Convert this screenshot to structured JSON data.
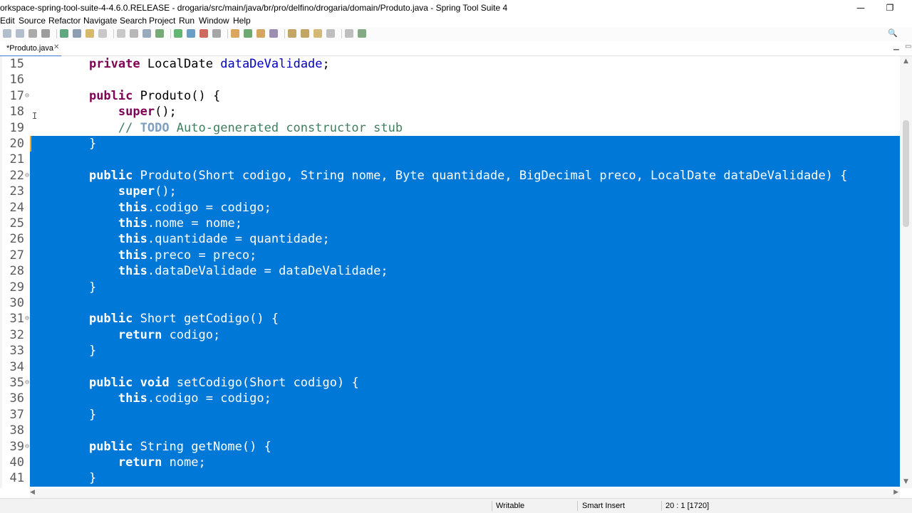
{
  "window": {
    "title": "orkspace-spring-tool-suite-4-4.6.0.RELEASE - drogaria/src/main/java/br/pro/delfino/drogaria/domain/Produto.java - Spring Tool Suite 4",
    "minimize": "—",
    "maximize": "❐"
  },
  "menu": [
    "Edit",
    "Source",
    "Refactor",
    "Navigate",
    "Search",
    "Project",
    "Run",
    "Window",
    "Help"
  ],
  "toolbar": {
    "icons": [
      "save-icon",
      "save-all-icon",
      "print-icon",
      "cut-icon",
      "debug-icon",
      "build-icon",
      "toggle-mark-icon",
      "block-select-icon",
      "show-whitespace-icon",
      "paragraph-icon",
      "skip-breakpoints-icon",
      "run-debug-icon",
      "run-icon",
      "run-coverage-icon",
      "stop-icon",
      "external-tools-icon",
      "new-java-icon",
      "new-class-icon",
      "open-type-icon",
      "search-icon",
      "next-annotation-icon",
      "prev-annotation-icon",
      "last-edit-icon",
      "back-icon",
      "forward-icon",
      "pin-editor-icon"
    ],
    "search_icon": "🔍"
  },
  "editor_tab": {
    "label": "*Produto.java",
    "close": "✕"
  },
  "code": {
    "lines": [
      {
        "n": "15",
        "fold": "",
        "sel": false,
        "tokens": [
          [
            "",
            "    "
          ],
          [
            "kw",
            "private"
          ],
          [
            "",
            " "
          ],
          [
            "ty",
            "LocalDate"
          ],
          [
            "",
            " "
          ],
          [
            "fld",
            "dataDeValidade"
          ],
          [
            "",
            ";"
          ]
        ]
      },
      {
        "n": "16",
        "fold": "",
        "sel": false,
        "tokens": []
      },
      {
        "n": "17",
        "fold": "⊖",
        "sel": false,
        "tokens": [
          [
            "",
            "    "
          ],
          [
            "kw",
            "public"
          ],
          [
            "",
            " Produto() {"
          ]
        ]
      },
      {
        "n": "18",
        "fold": "",
        "sel": false,
        "tokens": [
          [
            "",
            "        "
          ],
          [
            "kw",
            "super"
          ],
          [
            "",
            "();"
          ]
        ]
      },
      {
        "n": "19",
        "fold": "",
        "sel": false,
        "tokens": [
          [
            "",
            "        "
          ],
          [
            "cm",
            "// "
          ],
          [
            "todo",
            "TODO"
          ],
          [
            "cm",
            " Auto-generated constructor stub"
          ]
        ]
      },
      {
        "n": "20",
        "fold": "",
        "sel": true,
        "tokens": [
          [
            "",
            "    }"
          ]
        ]
      },
      {
        "n": "21",
        "fold": "",
        "sel": true,
        "tokens": []
      },
      {
        "n": "22",
        "fold": "⊖",
        "sel": true,
        "tokens": [
          [
            "",
            "    "
          ],
          [
            "kw",
            "public"
          ],
          [
            "",
            " Produto(Short codigo, String nome, Byte quantidade, BigDecimal preco, LocalDate dataDeValidade) {"
          ]
        ]
      },
      {
        "n": "23",
        "fold": "",
        "sel": true,
        "tokens": [
          [
            "",
            "        "
          ],
          [
            "kw",
            "super"
          ],
          [
            "",
            "();"
          ]
        ]
      },
      {
        "n": "24",
        "fold": "",
        "sel": true,
        "tokens": [
          [
            "",
            "        "
          ],
          [
            "kw",
            "this"
          ],
          [
            "",
            "."
          ],
          [
            "fld",
            "codigo"
          ],
          [
            "",
            " = codigo;"
          ]
        ]
      },
      {
        "n": "25",
        "fold": "",
        "sel": true,
        "tokens": [
          [
            "",
            "        "
          ],
          [
            "kw",
            "this"
          ],
          [
            "",
            "."
          ],
          [
            "fld",
            "nome"
          ],
          [
            "",
            " = nome;"
          ]
        ]
      },
      {
        "n": "26",
        "fold": "",
        "sel": true,
        "tokens": [
          [
            "",
            "        "
          ],
          [
            "kw",
            "this"
          ],
          [
            "",
            "."
          ],
          [
            "fld",
            "quantidade"
          ],
          [
            "",
            " = quantidade;"
          ]
        ]
      },
      {
        "n": "27",
        "fold": "",
        "sel": true,
        "tokens": [
          [
            "",
            "        "
          ],
          [
            "kw",
            "this"
          ],
          [
            "",
            "."
          ],
          [
            "fld",
            "preco"
          ],
          [
            "",
            " = preco;"
          ]
        ]
      },
      {
        "n": "28",
        "fold": "",
        "sel": true,
        "tokens": [
          [
            "",
            "        "
          ],
          [
            "kw",
            "this"
          ],
          [
            "",
            "."
          ],
          [
            "fld",
            "dataDeValidade"
          ],
          [
            "",
            " = dataDeValidade;"
          ]
        ]
      },
      {
        "n": "29",
        "fold": "",
        "sel": true,
        "tokens": [
          [
            "",
            "    }"
          ]
        ]
      },
      {
        "n": "30",
        "fold": "",
        "sel": true,
        "tokens": []
      },
      {
        "n": "31",
        "fold": "⊖",
        "sel": true,
        "tokens": [
          [
            "",
            "    "
          ],
          [
            "kw",
            "public"
          ],
          [
            "",
            " Short getCodigo() {"
          ]
        ]
      },
      {
        "n": "32",
        "fold": "",
        "sel": true,
        "tokens": [
          [
            "",
            "        "
          ],
          [
            "kw",
            "return"
          ],
          [
            "",
            " "
          ],
          [
            "fld",
            "codigo"
          ],
          [
            "",
            ";"
          ]
        ]
      },
      {
        "n": "33",
        "fold": "",
        "sel": true,
        "tokens": [
          [
            "",
            "    }"
          ]
        ]
      },
      {
        "n": "34",
        "fold": "",
        "sel": true,
        "tokens": []
      },
      {
        "n": "35",
        "fold": "⊖",
        "sel": true,
        "tokens": [
          [
            "",
            "    "
          ],
          [
            "kw",
            "public"
          ],
          [
            "",
            " "
          ],
          [
            "kw",
            "void"
          ],
          [
            "",
            " setCodigo(Short codigo) {"
          ]
        ]
      },
      {
        "n": "36",
        "fold": "",
        "sel": true,
        "tokens": [
          [
            "",
            "        "
          ],
          [
            "kw",
            "this"
          ],
          [
            "",
            "."
          ],
          [
            "fld",
            "codigo"
          ],
          [
            "",
            " = codigo;"
          ]
        ]
      },
      {
        "n": "37",
        "fold": "",
        "sel": true,
        "tokens": [
          [
            "",
            "    }"
          ]
        ]
      },
      {
        "n": "38",
        "fold": "",
        "sel": true,
        "tokens": []
      },
      {
        "n": "39",
        "fold": "⊖",
        "sel": true,
        "tokens": [
          [
            "",
            "    "
          ],
          [
            "kw",
            "public"
          ],
          [
            "",
            " String getNome() {"
          ]
        ]
      },
      {
        "n": "40",
        "fold": "",
        "sel": true,
        "tokens": [
          [
            "",
            "        "
          ],
          [
            "kw",
            "return"
          ],
          [
            "",
            " "
          ],
          [
            "fld",
            "nome"
          ],
          [
            "",
            ";"
          ]
        ]
      },
      {
        "n": "41",
        "fold": "",
        "sel": true,
        "tokens": [
          [
            "",
            "    }"
          ]
        ]
      }
    ]
  },
  "status": {
    "writable": "Writable",
    "insert_mode": "Smart Insert",
    "position": "20 : 1 [1720]"
  },
  "colors": {
    "selection": "#0078d7",
    "keyword": "#7f0055",
    "field": "#0000c0",
    "comment": "#3f7f5f"
  }
}
